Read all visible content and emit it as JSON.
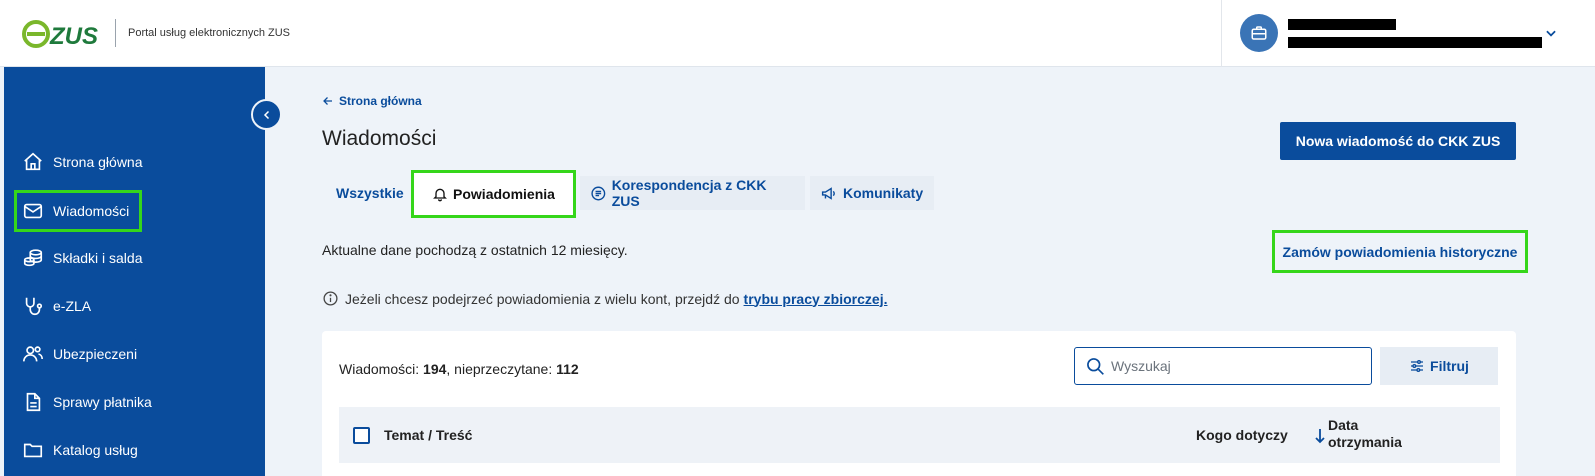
{
  "header": {
    "logo_text": "eZUS",
    "portal_title": "Portal usług elektronicznych ZUS"
  },
  "sidebar": {
    "items": [
      {
        "label": "Strona główna",
        "icon": "home-icon"
      },
      {
        "label": "Wiadomości",
        "icon": "mail-icon"
      },
      {
        "label": "Składki i salda",
        "icon": "coins-icon"
      },
      {
        "label": "e-ZLA",
        "icon": "stethoscope-icon"
      },
      {
        "label": "Ubezpieczeni",
        "icon": "users-icon"
      },
      {
        "label": "Sprawy płatnika",
        "icon": "document-icon"
      },
      {
        "label": "Katalog usług",
        "icon": "folder-icon"
      }
    ]
  },
  "main": {
    "breadcrumb": "Strona główna",
    "title": "Wiadomości",
    "new_message_button": "Nowa wiadomość do CKK ZUS",
    "tabs": [
      {
        "label": "Wszystkie"
      },
      {
        "label": "Powiadomienia"
      },
      {
        "label": "Korespondencja z CKK ZUS"
      },
      {
        "label": "Komunikaty"
      }
    ],
    "info_text": "Aktualne dane pochodzą z ostatnich 12 miesięcy.",
    "historic_link": "Zamów powiadomienia historyczne",
    "hint_text": "Jeżeli chcesz podejrzeć powiadomienia z wielu kont, przejdź do",
    "hint_link": "trybu pracy zbiorczej."
  },
  "list": {
    "count_label": "Wiadomości:",
    "count_value": "194",
    "unread_label": ", nieprzeczytane:",
    "unread_value": "112",
    "search_placeholder": "Wyszukaj",
    "filter_button": "Filtruj",
    "columns": {
      "subject": "Temat / Treść",
      "who": "Kogo dotyczy",
      "date": "Data otrzymania"
    }
  },
  "colors": {
    "primary": "#0a4c9c",
    "highlight": "#35d61a",
    "logo_green": "#7ab72b"
  }
}
